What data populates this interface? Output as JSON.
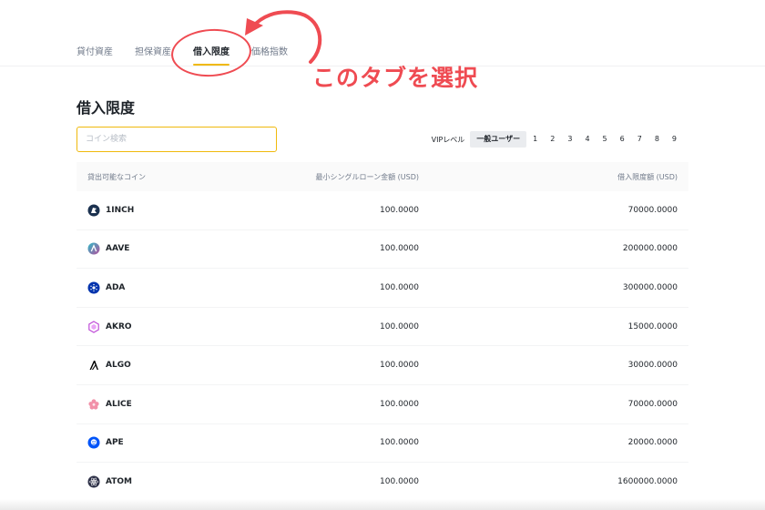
{
  "tabs": [
    {
      "label": "貸付資産",
      "active": false
    },
    {
      "label": "担保資産",
      "active": false
    },
    {
      "label": "借入限度",
      "active": true
    },
    {
      "label": "価格指数",
      "active": false
    }
  ],
  "page_title": "借入限度",
  "search": {
    "placeholder": "コイン検索"
  },
  "vip": {
    "label": "VIPレベル",
    "options": [
      "一般ユーザー",
      "1",
      "2",
      "3",
      "4",
      "5",
      "6",
      "7",
      "8",
      "9"
    ],
    "selected": "一般ユーザー"
  },
  "table": {
    "headers": {
      "coin": "貸出可能なコイン",
      "min": "最小シングルローン金額 (USD)",
      "limit": "借入限度額 (USD)"
    },
    "rows": [
      {
        "coin": "1INCH",
        "min": "100.0000",
        "limit": "70000.0000",
        "icon": "1inch-icon"
      },
      {
        "coin": "AAVE",
        "min": "100.0000",
        "limit": "200000.0000",
        "icon": "aave-icon"
      },
      {
        "coin": "ADA",
        "min": "100.0000",
        "limit": "300000.0000",
        "icon": "ada-icon"
      },
      {
        "coin": "AKRO",
        "min": "100.0000",
        "limit": "15000.0000",
        "icon": "akro-icon"
      },
      {
        "coin": "ALGO",
        "min": "100.0000",
        "limit": "30000.0000",
        "icon": "algo-icon"
      },
      {
        "coin": "ALICE",
        "min": "100.0000",
        "limit": "70000.0000",
        "icon": "alice-icon"
      },
      {
        "coin": "APE",
        "min": "100.0000",
        "limit": "20000.0000",
        "icon": "ape-icon"
      },
      {
        "coin": "ATOM",
        "min": "100.0000",
        "limit": "1600000.0000",
        "icon": "atom-icon"
      }
    ]
  },
  "annotation": {
    "text": "このタブを選択"
  },
  "colors": {
    "accent": "#f0b90b",
    "annotation": "#ef4b52",
    "text": "#1e2329",
    "muted": "#707a8a"
  }
}
